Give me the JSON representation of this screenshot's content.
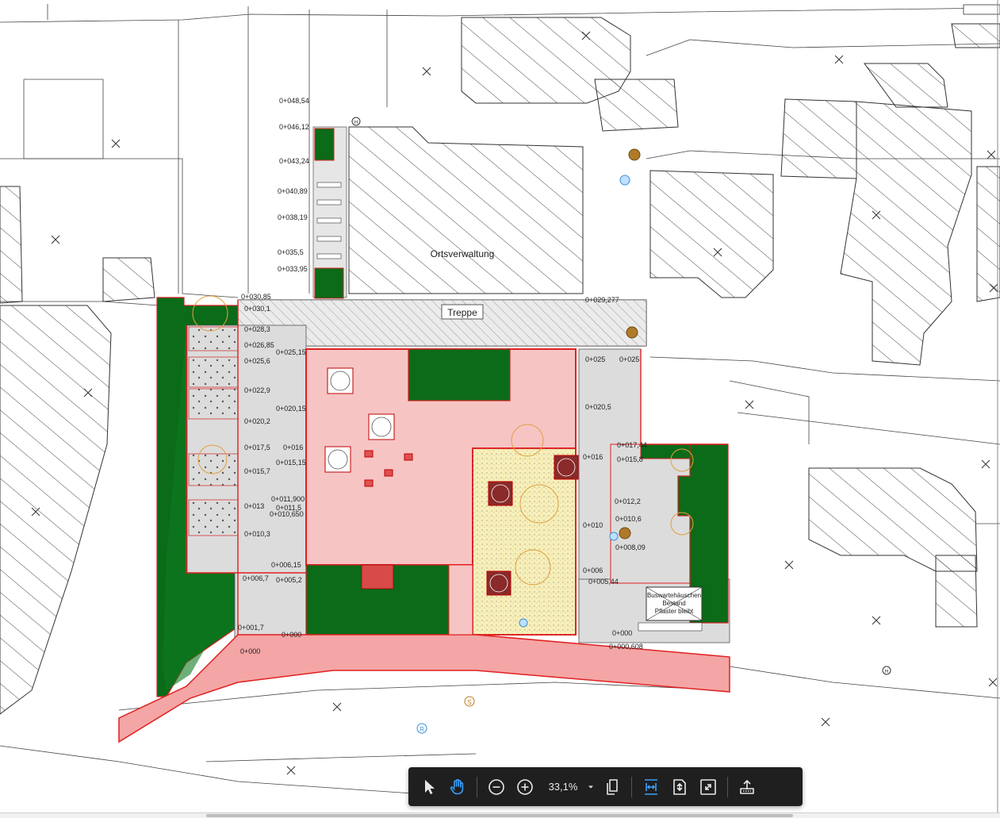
{
  "viewer": {
    "zoom_level": "33,1%",
    "tools": {
      "select": "select-tool",
      "hand": "hand-tool",
      "zoom_out": "zoom-out",
      "zoom_in": "zoom-in",
      "page_view": "page-view",
      "fit_width": "fit-width",
      "fit_page": "fit-page",
      "full_screen": "full-screen",
      "share": "share"
    },
    "colors": {
      "toolbar_bg": "#1f1f1f",
      "active_tool": "#3aa0ff",
      "icon": "#e8e8e8"
    }
  },
  "plan": {
    "building_label": "Ortsverwaltung",
    "stairs_label": "Treppe",
    "bus_shelter": [
      "Buswartehäuschen",
      "Bestand",
      "Pflaster bleibt"
    ],
    "symbol_h": "H",
    "symbol_s": "S",
    "symbol_r": "R",
    "stations_left": [
      "0+048,54",
      "0+046,12",
      "0+043,24",
      "0+040,89",
      "0+038,19",
      "0+035,5",
      "0+033,95",
      "0+030,85",
      "0+030,1",
      "0+028,3",
      "0+026,85",
      "0+025,15",
      "0+025,6",
      "0+022,9",
      "0+020,15",
      "0+020,2",
      "0+017,5",
      "0+016",
      "0+015,15",
      "0+015,7",
      "0+011,900",
      "0+013",
      "0+011,5",
      "0+010,650",
      "0+010,3",
      "0+006,15",
      "0+006,7",
      "0+005,2",
      "0+001,7",
      "0+000",
      "0+000"
    ],
    "stations_right": [
      "0+029,277",
      "0+025",
      "0+025",
      "0+020,5",
      "0+017,44",
      "0+016",
      "0+015,8",
      "0+012,2",
      "0+010,6",
      "0+010",
      "0+008,09",
      "0+006",
      "0+005,44",
      "0+000",
      "0+000,608"
    ],
    "colors": {
      "green": "#0b6b18",
      "pink": "#f4a5a5",
      "light_pink": "#fbd0d0",
      "yellow": "#f4f1b8",
      "grey": "#e0e0e0",
      "red": "#e02020"
    }
  }
}
